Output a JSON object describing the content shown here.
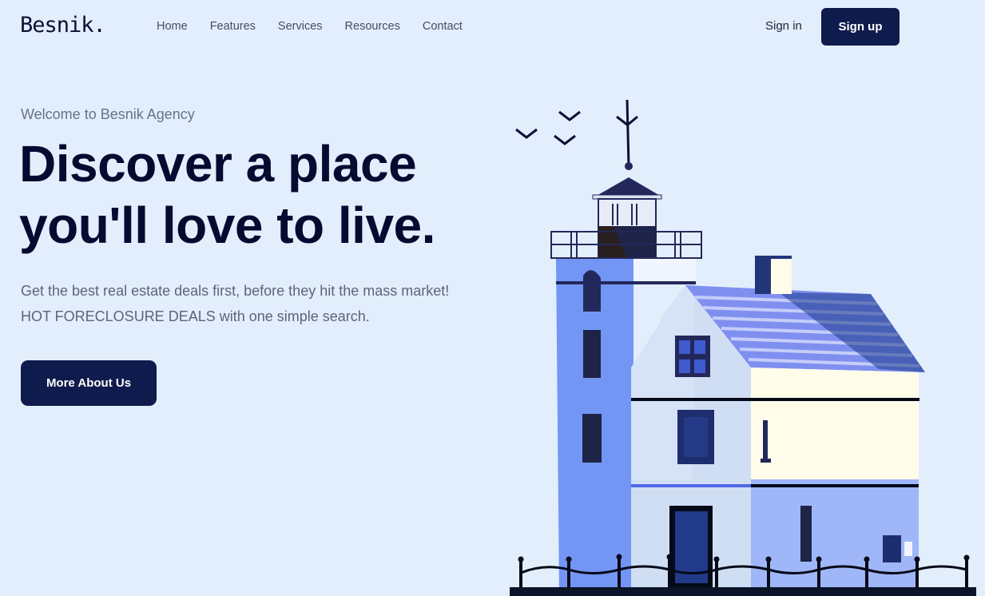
{
  "brand": {
    "logo_text": "Besnik."
  },
  "nav": {
    "items": [
      "Home",
      "Features",
      "Services",
      "Resources",
      "Contact"
    ]
  },
  "auth": {
    "signin_label": "Sign in",
    "signup_label": "Sign up"
  },
  "hero": {
    "eyebrow": "Welcome to Besnik Agency",
    "headline_line1": "Discover a place",
    "headline_line2": "you'll love to live.",
    "subtext": "Get the best real estate deals first, before they hit the mass market! HOT FORECLOSURE DEALS with one simple search.",
    "cta_label": "More About Us"
  },
  "colors": {
    "background": "#e2eefc",
    "primary": "#0f1b4c",
    "headline": "#050a30",
    "tower_blue": "#7396f5",
    "roof_blue": "#7f8ff0",
    "cream": "#fffcea"
  },
  "icons": {
    "illustration": "lighthouse-house-illustration",
    "birds": "bird-icon"
  }
}
